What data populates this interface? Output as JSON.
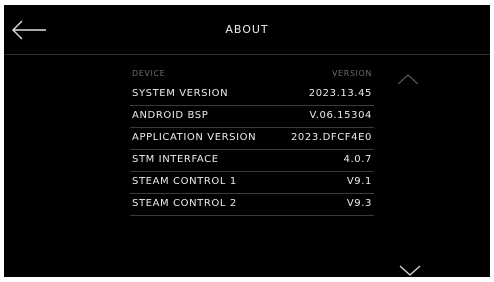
{
  "header": {
    "title": "ABOUT",
    "back_icon": "arrow-left-icon"
  },
  "table": {
    "columns": [
      "DEVICE",
      "VERSION"
    ],
    "rows": [
      {
        "label": "SYSTEM VERSION",
        "value": "2023.13.45"
      },
      {
        "label": "ANDROID BSP",
        "value": "V.06.15304"
      },
      {
        "label": "APPLICATION VERSION",
        "value": "2023.DFCF4E0"
      },
      {
        "label": "STM INTERFACE",
        "value": "4.0.7"
      },
      {
        "label": "STEAM CONTROL 1",
        "value": "V9.1"
      },
      {
        "label": "STEAM CONTROL 2",
        "value": "V9.3"
      }
    ]
  },
  "scroll": {
    "up_icon": "chevron-up-icon",
    "down_icon": "chevron-down-icon"
  },
  "colors": {
    "background": "#000000",
    "text": "#ececec",
    "muted": "#6a6a6a",
    "divider": "#3a3a3a",
    "scroll_up": "#555555",
    "scroll_down": "#d8d8d8"
  }
}
